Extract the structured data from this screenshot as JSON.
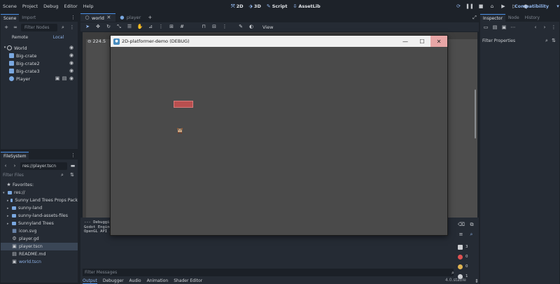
{
  "menubar": {
    "items": [
      "Scene",
      "Project",
      "Debug",
      "Editor",
      "Help"
    ],
    "workspaces": [
      {
        "icon": "2d-icon",
        "glyph": "⤧",
        "label": "2D"
      },
      {
        "icon": "3d-icon",
        "glyph": "⬗",
        "label": "3D"
      },
      {
        "icon": "script-icon",
        "glyph": "✎",
        "label": "Script"
      },
      {
        "icon": "assetlib-icon",
        "glyph": "⇩",
        "label": "AssetLib"
      }
    ],
    "renderer": "Compatibility"
  },
  "scene_dock": {
    "tabs": [
      "Scene",
      "Import"
    ],
    "filter_placeholder": "Filter Nodes",
    "remote_label": "Remote",
    "local_label": "Local",
    "tree": [
      {
        "label": "World",
        "level": 0,
        "icon": "node2d-icon",
        "color": "#c4c7cc"
      },
      {
        "label": "Big-crate",
        "level": 1,
        "icon": "rigidbody-icon",
        "color": "#7aa8e0"
      },
      {
        "label": "Big-crate2",
        "level": 1,
        "icon": "rigidbody-icon",
        "color": "#7aa8e0"
      },
      {
        "label": "Big-crate3",
        "level": 1,
        "icon": "rigidbody-icon",
        "color": "#7aa8e0"
      },
      {
        "label": "Player",
        "level": 1,
        "icon": "characterbody-icon",
        "color": "#7aa8e0"
      }
    ]
  },
  "filesystem": {
    "tab": "FileSystem",
    "path": "res://player.tscn",
    "filter_placeholder": "Filter Files",
    "favorites_label": "Favorites:",
    "root_label": "res://",
    "entries": [
      {
        "label": "Sunny Land Trees Props Pack",
        "type": "folder"
      },
      {
        "label": "sunny-land",
        "type": "folder"
      },
      {
        "label": "sunny-land-assets-files",
        "type": "folder"
      },
      {
        "label": "Sunnyland Trees",
        "type": "folder"
      },
      {
        "label": "icon.svg",
        "type": "image"
      },
      {
        "label": "player.gd",
        "type": "script"
      },
      {
        "label": "player.tscn",
        "type": "scene",
        "selected": true
      },
      {
        "label": "README.md",
        "type": "text"
      },
      {
        "label": "world.tscn",
        "type": "scene",
        "accent": true
      }
    ]
  },
  "scene_tabs": [
    {
      "label": "world",
      "active": true
    },
    {
      "label": "player",
      "active": false
    }
  ],
  "toolbar": {
    "view_label": "View"
  },
  "viewport": {
    "zoom": "224.5"
  },
  "bottom_panel": {
    "log_lines": [
      "--- Debugging process started ---",
      "Godot Engine v4.0.stable.official",
      "OpenGL API 3.3"
    ],
    "filter_placeholder": "Filter Messages",
    "tabs": [
      "Output",
      "Debugger",
      "Audio",
      "Animation",
      "Shader Editor"
    ],
    "version": "4.0.stable",
    "counters": [
      {
        "icon": "message-icon",
        "value": "3",
        "color": "#cdd0d4"
      },
      {
        "icon": "error-icon",
        "value": "0",
        "color": "#e05252"
      },
      {
        "icon": "warning-icon",
        "value": "0",
        "color": "#e0b452"
      },
      {
        "icon": "info-icon",
        "value": "1",
        "color": "#cdd0d4"
      }
    ]
  },
  "game_window": {
    "title": "2D-platformer-demo (DEBUG)"
  },
  "inspector": {
    "tabs": [
      "Inspector",
      "Node",
      "History"
    ],
    "filter_placeholder": "Filter Properties"
  }
}
